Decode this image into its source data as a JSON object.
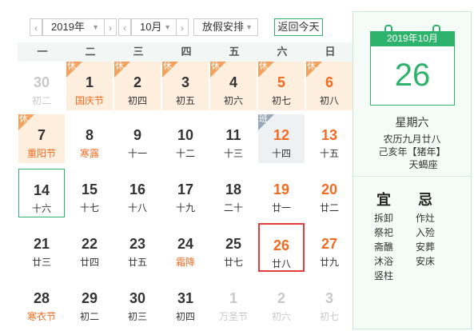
{
  "toolbar": {
    "prev_year": "‹",
    "year": "2019年",
    "next_year": "›",
    "prev_month": "‹",
    "month": "10月",
    "next_month": "›",
    "holiday": "放假安排",
    "today_button": "返回今天"
  },
  "weekdays": [
    "一",
    "二",
    "三",
    "四",
    "五",
    "六",
    "日"
  ],
  "days": [
    {
      "d": "30",
      "l": "初二",
      "other": true
    },
    {
      "d": "1",
      "l": "国庆节",
      "tag": "休",
      "fest": true
    },
    {
      "d": "2",
      "l": "初四",
      "tag": "休"
    },
    {
      "d": "3",
      "l": "初五",
      "tag": "休"
    },
    {
      "d": "4",
      "l": "初六",
      "tag": "休"
    },
    {
      "d": "5",
      "l": "初七",
      "tag": "休",
      "weekend": true
    },
    {
      "d": "6",
      "l": "初八",
      "tag": "休",
      "weekend": true
    },
    {
      "d": "7",
      "l": "重阳节",
      "tag": "休",
      "fest": true
    },
    {
      "d": "8",
      "l": "寒露",
      "fest": true
    },
    {
      "d": "9",
      "l": "十一"
    },
    {
      "d": "10",
      "l": "十二"
    },
    {
      "d": "11",
      "l": "十三"
    },
    {
      "d": "12",
      "l": "十四",
      "tag": "班",
      "work": true,
      "weekend": true
    },
    {
      "d": "13",
      "l": "十五",
      "weekend": true
    },
    {
      "d": "14",
      "l": "十六",
      "today": true
    },
    {
      "d": "15",
      "l": "十七"
    },
    {
      "d": "16",
      "l": "十八"
    },
    {
      "d": "17",
      "l": "十九"
    },
    {
      "d": "18",
      "l": "二十"
    },
    {
      "d": "19",
      "l": "廿一",
      "weekend": true
    },
    {
      "d": "20",
      "l": "廿二",
      "weekend": true
    },
    {
      "d": "21",
      "l": "廿三"
    },
    {
      "d": "22",
      "l": "廿四"
    },
    {
      "d": "23",
      "l": "廿五"
    },
    {
      "d": "24",
      "l": "霜降",
      "fest": true
    },
    {
      "d": "25",
      "l": "廿七"
    },
    {
      "d": "26",
      "l": "廿八",
      "weekend": true,
      "selected": true
    },
    {
      "d": "27",
      "l": "廿九",
      "weekend": true
    },
    {
      "d": "28",
      "l": "寒衣节",
      "fest": true
    },
    {
      "d": "29",
      "l": "初二"
    },
    {
      "d": "30",
      "l": "初三"
    },
    {
      "d": "31",
      "l": "初四"
    },
    {
      "d": "1",
      "l": "万圣节",
      "other": true
    },
    {
      "d": "2",
      "l": "初六",
      "other": true
    },
    {
      "d": "3",
      "l": "初七",
      "other": true
    }
  ],
  "panel": {
    "header": "2019年10月",
    "day": "26",
    "weekday": "星期六",
    "lunar": "农历九月廿八",
    "ganzhi": "己亥年【猪年】",
    "zodiac": "天蝎座",
    "yi_title": "宜",
    "ji_title": "忌",
    "yi": [
      "拆卸",
      "祭祀",
      "斋醮",
      "沐浴",
      "竖柱"
    ],
    "ji": [
      "作灶",
      "入殓",
      "安葬",
      "安床"
    ]
  },
  "colors": {
    "accent": "#2db36b",
    "holiday": "#f26b21",
    "holiday_bg": "#fdeedd",
    "selected": "#e23c3c"
  }
}
